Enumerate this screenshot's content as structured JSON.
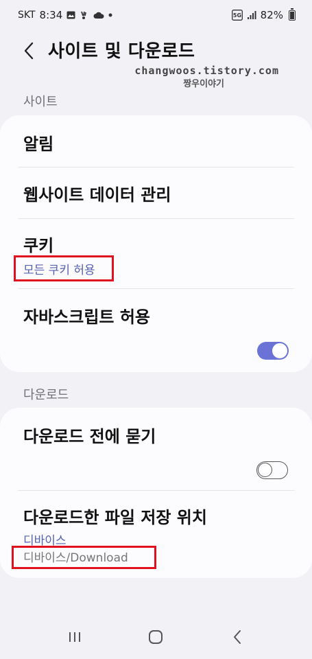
{
  "status": {
    "carrier": "SKT",
    "time": "8:34",
    "battery": "82%",
    "battery_level": 0.82,
    "network": "5G"
  },
  "header": {
    "title": "사이트 및 다운로드"
  },
  "watermark": {
    "url": "changwoos.tistory.com",
    "name": "짱우이야기"
  },
  "sites": {
    "header": "사이트",
    "items": [
      {
        "title": "알림"
      },
      {
        "title": "웹사이트 데이터 관리"
      },
      {
        "title": "쿠키",
        "subtitle": "모든 쿠키 허용"
      },
      {
        "title": "자바스크립트 허용",
        "toggle": true
      }
    ]
  },
  "downloads": {
    "header": "다운로드",
    "items": [
      {
        "title": "다운로드 전에 묻기",
        "toggle": false
      },
      {
        "title": "다운로드한 파일 저장 위치",
        "subtitle": "디바이스",
        "detail": "디바이스/Download"
      }
    ]
  },
  "colors": {
    "accent": "#6b74d6",
    "link": "#5662b3",
    "highlight": "#e01020",
    "background": "#f2f1f6",
    "card": "#fcfcfe"
  }
}
